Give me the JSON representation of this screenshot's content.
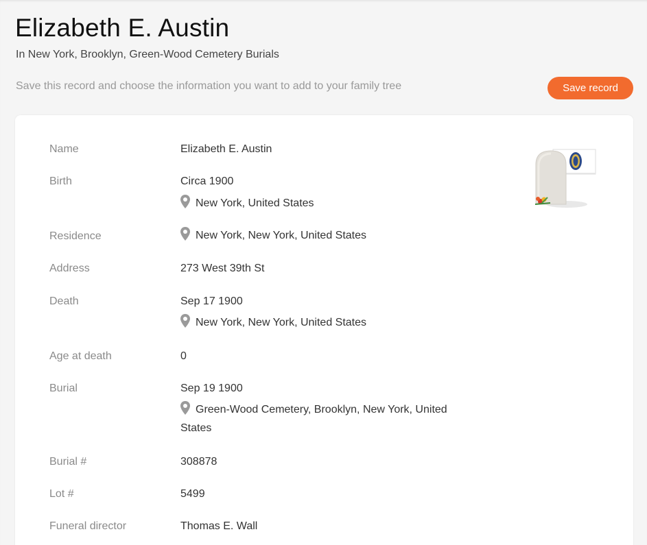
{
  "header": {
    "title": "Elizabeth E. Austin",
    "subtitle": "In New York, Brooklyn, Green-Wood Cemetery Burials",
    "hint": "Save this record and choose the information you want to add to your family tree",
    "save_label": "Save record"
  },
  "colors": {
    "accent": "#f26b2e",
    "label": "#8a8a8a",
    "value": "#333333"
  },
  "thumbnail": {
    "icon": "gravestone-flag-icon"
  },
  "record": {
    "name": {
      "label": "Name",
      "value": "Elizabeth E. Austin"
    },
    "birth": {
      "label": "Birth",
      "value": "Circa 1900",
      "place": "New York, United States"
    },
    "residence": {
      "label": "Residence",
      "place": "New York, New York, United States"
    },
    "address": {
      "label": "Address",
      "value": "273 West 39th St"
    },
    "death": {
      "label": "Death",
      "value": "Sep 17 1900",
      "place": "New York, New York, United States"
    },
    "age": {
      "label": "Age at death",
      "value": "0"
    },
    "burial": {
      "label": "Burial",
      "value": "Sep 19 1900",
      "place_line1": "Green-Wood Cemetery, Brooklyn, New York, United",
      "place_line2": "States"
    },
    "burial_no": {
      "label": "Burial #",
      "value": "308878"
    },
    "lot_no": {
      "label": "Lot #",
      "value": "5499"
    },
    "funeral_director": {
      "label": "Funeral director",
      "value": "Thomas E. Wall"
    }
  }
}
